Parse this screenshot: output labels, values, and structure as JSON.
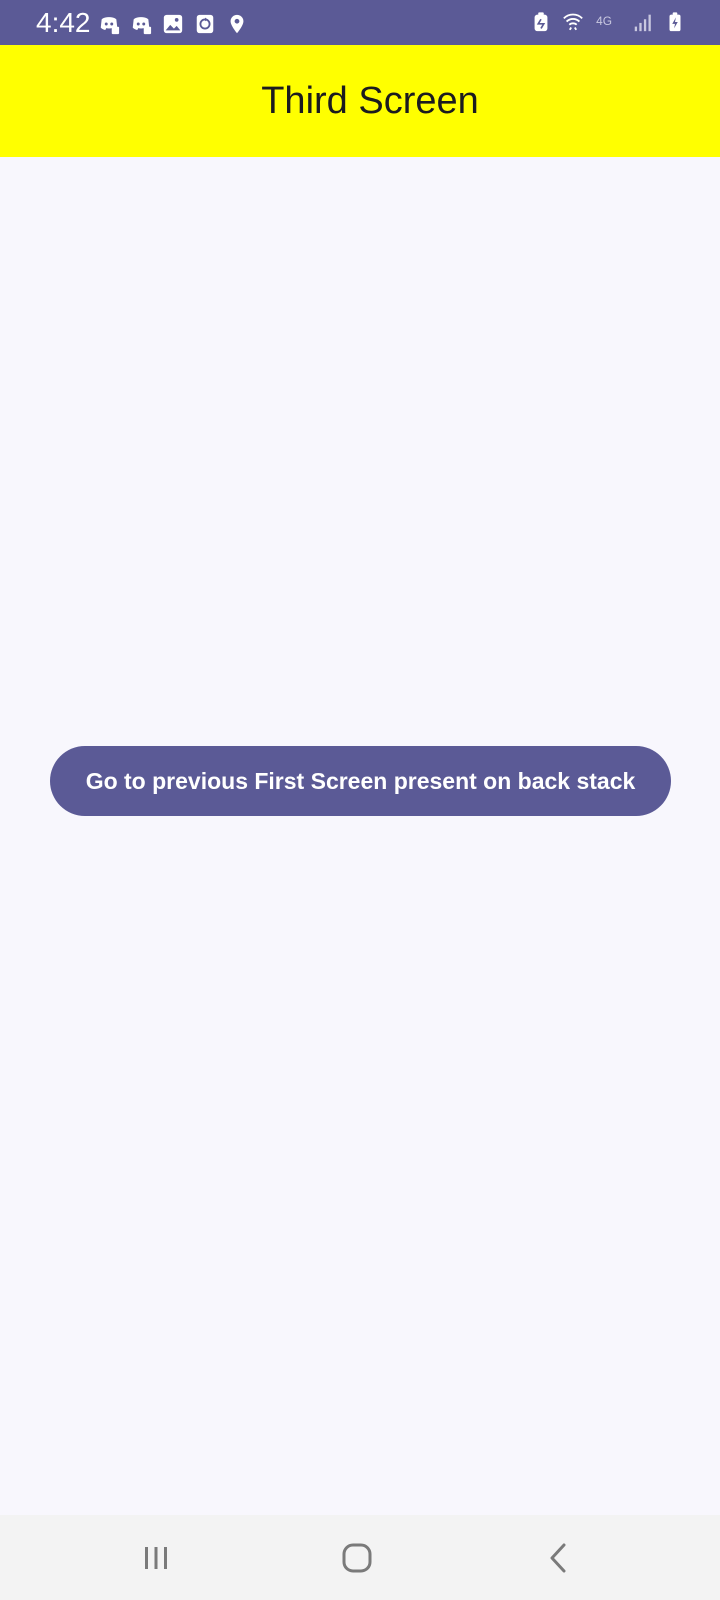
{
  "status_bar": {
    "time": "4:42",
    "network_label": "4G",
    "left_icons": [
      "discord-icon",
      "discord-icon",
      "gallery-icon",
      "sync-icon",
      "location-icon"
    ],
    "right_icons": [
      "battery-saver-icon",
      "wifi-icon",
      "network-4g-icon",
      "signal-icon",
      "battery-charging-icon"
    ]
  },
  "app_bar": {
    "title": "Third Screen",
    "background": "#ffff00"
  },
  "main": {
    "button_label": "Go to previous First Screen present on back stack",
    "button_color": "#5b5a96"
  },
  "nav_bar": {
    "items": [
      "recents-icon",
      "home-icon",
      "back-icon"
    ]
  }
}
